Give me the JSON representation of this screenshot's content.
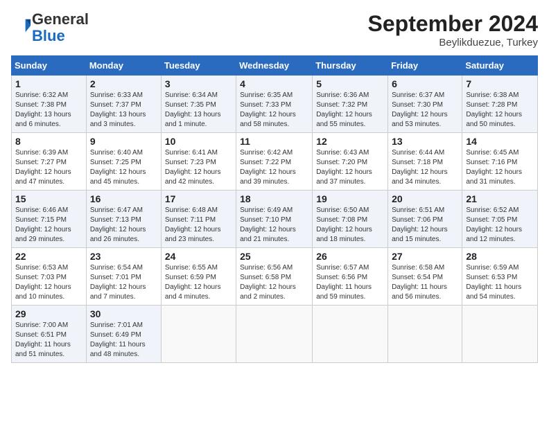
{
  "logo": {
    "general": "General",
    "blue": "Blue"
  },
  "title": "September 2024",
  "location": "Beylikduezue, Turkey",
  "days_header": [
    "Sunday",
    "Monday",
    "Tuesday",
    "Wednesday",
    "Thursday",
    "Friday",
    "Saturday"
  ],
  "weeks": [
    [
      {
        "day": "1",
        "sunrise": "Sunrise: 6:32 AM",
        "sunset": "Sunset: 7:38 PM",
        "daylight": "Daylight: 13 hours and 6 minutes."
      },
      {
        "day": "2",
        "sunrise": "Sunrise: 6:33 AM",
        "sunset": "Sunset: 7:37 PM",
        "daylight": "Daylight: 13 hours and 3 minutes."
      },
      {
        "day": "3",
        "sunrise": "Sunrise: 6:34 AM",
        "sunset": "Sunset: 7:35 PM",
        "daylight": "Daylight: 13 hours and 1 minute."
      },
      {
        "day": "4",
        "sunrise": "Sunrise: 6:35 AM",
        "sunset": "Sunset: 7:33 PM",
        "daylight": "Daylight: 12 hours and 58 minutes."
      },
      {
        "day": "5",
        "sunrise": "Sunrise: 6:36 AM",
        "sunset": "Sunset: 7:32 PM",
        "daylight": "Daylight: 12 hours and 55 minutes."
      },
      {
        "day": "6",
        "sunrise": "Sunrise: 6:37 AM",
        "sunset": "Sunset: 7:30 PM",
        "daylight": "Daylight: 12 hours and 53 minutes."
      },
      {
        "day": "7",
        "sunrise": "Sunrise: 6:38 AM",
        "sunset": "Sunset: 7:28 PM",
        "daylight": "Daylight: 12 hours and 50 minutes."
      }
    ],
    [
      {
        "day": "8",
        "sunrise": "Sunrise: 6:39 AM",
        "sunset": "Sunset: 7:27 PM",
        "daylight": "Daylight: 12 hours and 47 minutes."
      },
      {
        "day": "9",
        "sunrise": "Sunrise: 6:40 AM",
        "sunset": "Sunset: 7:25 PM",
        "daylight": "Daylight: 12 hours and 45 minutes."
      },
      {
        "day": "10",
        "sunrise": "Sunrise: 6:41 AM",
        "sunset": "Sunset: 7:23 PM",
        "daylight": "Daylight: 12 hours and 42 minutes."
      },
      {
        "day": "11",
        "sunrise": "Sunrise: 6:42 AM",
        "sunset": "Sunset: 7:22 PM",
        "daylight": "Daylight: 12 hours and 39 minutes."
      },
      {
        "day": "12",
        "sunrise": "Sunrise: 6:43 AM",
        "sunset": "Sunset: 7:20 PM",
        "daylight": "Daylight: 12 hours and 37 minutes."
      },
      {
        "day": "13",
        "sunrise": "Sunrise: 6:44 AM",
        "sunset": "Sunset: 7:18 PM",
        "daylight": "Daylight: 12 hours and 34 minutes."
      },
      {
        "day": "14",
        "sunrise": "Sunrise: 6:45 AM",
        "sunset": "Sunset: 7:16 PM",
        "daylight": "Daylight: 12 hours and 31 minutes."
      }
    ],
    [
      {
        "day": "15",
        "sunrise": "Sunrise: 6:46 AM",
        "sunset": "Sunset: 7:15 PM",
        "daylight": "Daylight: 12 hours and 29 minutes."
      },
      {
        "day": "16",
        "sunrise": "Sunrise: 6:47 AM",
        "sunset": "Sunset: 7:13 PM",
        "daylight": "Daylight: 12 hours and 26 minutes."
      },
      {
        "day": "17",
        "sunrise": "Sunrise: 6:48 AM",
        "sunset": "Sunset: 7:11 PM",
        "daylight": "Daylight: 12 hours and 23 minutes."
      },
      {
        "day": "18",
        "sunrise": "Sunrise: 6:49 AM",
        "sunset": "Sunset: 7:10 PM",
        "daylight": "Daylight: 12 hours and 21 minutes."
      },
      {
        "day": "19",
        "sunrise": "Sunrise: 6:50 AM",
        "sunset": "Sunset: 7:08 PM",
        "daylight": "Daylight: 12 hours and 18 minutes."
      },
      {
        "day": "20",
        "sunrise": "Sunrise: 6:51 AM",
        "sunset": "Sunset: 7:06 PM",
        "daylight": "Daylight: 12 hours and 15 minutes."
      },
      {
        "day": "21",
        "sunrise": "Sunrise: 6:52 AM",
        "sunset": "Sunset: 7:05 PM",
        "daylight": "Daylight: 12 hours and 12 minutes."
      }
    ],
    [
      {
        "day": "22",
        "sunrise": "Sunrise: 6:53 AM",
        "sunset": "Sunset: 7:03 PM",
        "daylight": "Daylight: 12 hours and 10 minutes."
      },
      {
        "day": "23",
        "sunrise": "Sunrise: 6:54 AM",
        "sunset": "Sunset: 7:01 PM",
        "daylight": "Daylight: 12 hours and 7 minutes."
      },
      {
        "day": "24",
        "sunrise": "Sunrise: 6:55 AM",
        "sunset": "Sunset: 6:59 PM",
        "daylight": "Daylight: 12 hours and 4 minutes."
      },
      {
        "day": "25",
        "sunrise": "Sunrise: 6:56 AM",
        "sunset": "Sunset: 6:58 PM",
        "daylight": "Daylight: 12 hours and 2 minutes."
      },
      {
        "day": "26",
        "sunrise": "Sunrise: 6:57 AM",
        "sunset": "Sunset: 6:56 PM",
        "daylight": "Daylight: 11 hours and 59 minutes."
      },
      {
        "day": "27",
        "sunrise": "Sunrise: 6:58 AM",
        "sunset": "Sunset: 6:54 PM",
        "daylight": "Daylight: 11 hours and 56 minutes."
      },
      {
        "day": "28",
        "sunrise": "Sunrise: 6:59 AM",
        "sunset": "Sunset: 6:53 PM",
        "daylight": "Daylight: 11 hours and 54 minutes."
      }
    ],
    [
      {
        "day": "29",
        "sunrise": "Sunrise: 7:00 AM",
        "sunset": "Sunset: 6:51 PM",
        "daylight": "Daylight: 11 hours and 51 minutes."
      },
      {
        "day": "30",
        "sunrise": "Sunrise: 7:01 AM",
        "sunset": "Sunset: 6:49 PM",
        "daylight": "Daylight: 11 hours and 48 minutes."
      },
      null,
      null,
      null,
      null,
      null
    ]
  ]
}
